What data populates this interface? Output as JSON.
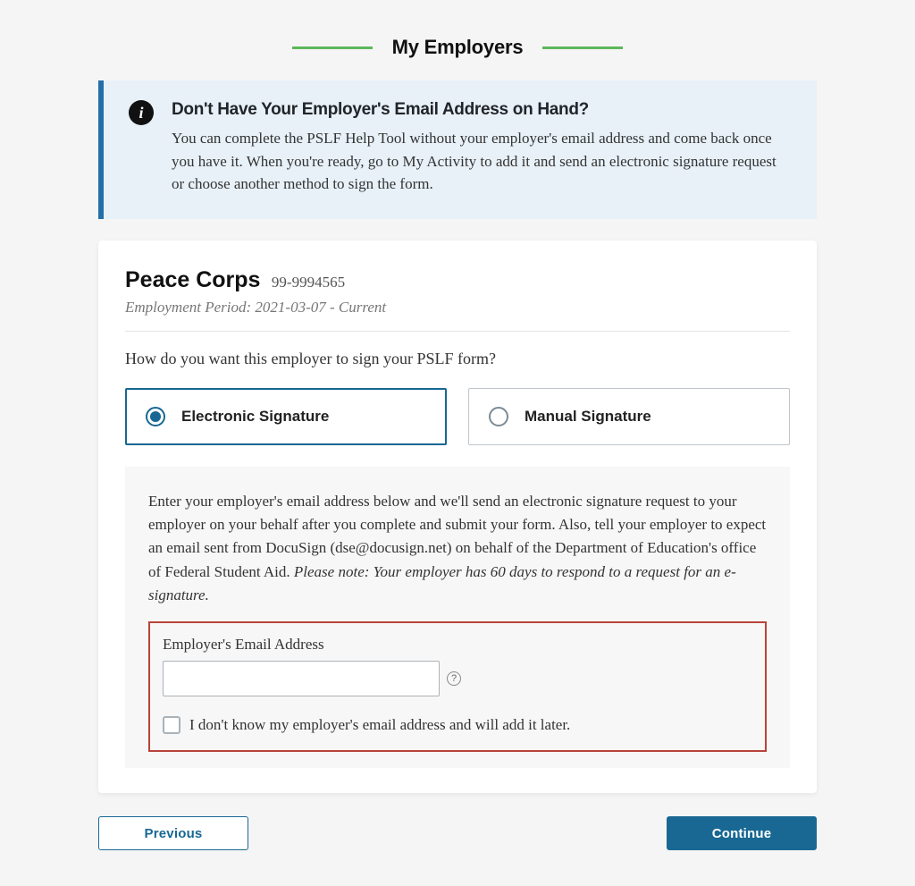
{
  "header": {
    "section_title": "My Employers"
  },
  "info_box": {
    "title": "Don't Have Your Employer's Email Address on Hand?",
    "body": "You can complete the PSLF Help Tool without your employer's email address and come back once you have it. When you're ready, go to My Activity to add it and send an electronic signature request or choose another method to sign the form."
  },
  "employer": {
    "name": "Peace Corps",
    "ein": "99-9994565",
    "period_label": "Employment Period: 2021-03-07 - Current"
  },
  "question": "How do you want this employer to sign your PSLF form?",
  "signature_options": {
    "electronic": {
      "label": "Electronic Signature",
      "selected": true
    },
    "manual": {
      "label": "Manual Signature",
      "selected": false
    }
  },
  "electronic_panel": {
    "text_main": "Enter your employer's email address below and we'll send an electronic signature request to your employer on your behalf after you complete and submit your form. Also, tell your employer to expect an email sent from DocuSign (dse@docusign.net) on behalf of the Department of Education's office of Federal Student Aid. ",
    "text_italic": "Please note: Your employer has 60 days to respond to a request for an e-signature.",
    "email_label": "Employer's Email Address",
    "email_value": "",
    "help_char": "?",
    "checkbox_label": "I don't know my employer's email address and will add it later."
  },
  "nav": {
    "previous": "Previous",
    "continue": "Continue"
  },
  "icons": {
    "info_glyph": "i"
  }
}
